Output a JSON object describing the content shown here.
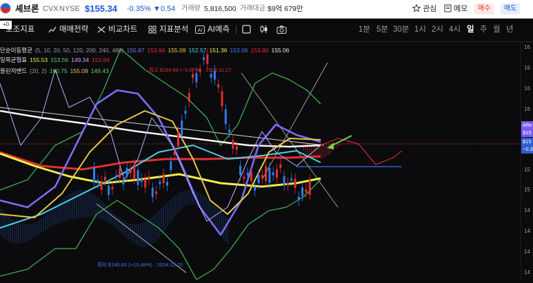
{
  "header": {
    "name": "셰브론",
    "ticker": "CVX",
    "exchange": "NYSE",
    "price": "$155.34",
    "change_pct": "-0.35%",
    "change_abs": "▼0.54",
    "volume_label": "거래량",
    "volume_value": "5,816,500",
    "amount_label": "거래대금",
    "amount_value": "$9억 679만",
    "watch_label": "관심",
    "memo_label": "메모",
    "buy_label": "매수",
    "sell_label": "매도"
  },
  "toolbar": {
    "tag": "+0",
    "aux_label": "보조지표",
    "strategy_label": "매매전략",
    "compare_label": "비교차트",
    "analysis_label": "지표분석",
    "ai_label": "AI예측",
    "periods": [
      "1분",
      "5분",
      "30분",
      "1시",
      "2시",
      "4시",
      "일",
      "주",
      "월",
      "년"
    ],
    "active_period": "일"
  },
  "legend": {
    "ma": {
      "label": "단순이동평균",
      "params": "(5, 10, 20, 50, 120, 200, 240, 480)",
      "values": [
        "155.87",
        "153.94",
        "155.09",
        "152.57",
        "151.36",
        "153.06",
        "153.80",
        "155.06"
      ]
    },
    "ichimoku": {
      "label": "일목균형표",
      "values": [
        "155.53",
        "153.56",
        "149.34",
        "152.64"
      ]
    },
    "bollinger": {
      "label": "볼린저밴드",
      "params": "(20, 2)",
      "values": [
        "160.75",
        "155.09",
        "149.43"
      ]
    }
  },
  "annotations": {
    "high": "최고 $164.68 (−5.67%) · 2024.11.27",
    "low": "최저 $140.60 (+10.48%) · 2024.12.20"
  },
  "axis": {
    "ticks": [
      "16",
      "16",
      "16",
      "16",
      "15",
      "15",
      "15",
      "14",
      "14",
      "14",
      "14"
    ],
    "after_hours_label": "Afte",
    "tag_price": "$15",
    "tag_change": "−0.3",
    "tag_price2": "$15"
  },
  "colors": {
    "up": "#e2312f",
    "down": "#2f7bf5",
    "accent": "#2b62c9"
  },
  "icons": {
    "aux": "indicator-icon",
    "strategy": "chart-icon",
    "compare": "compare-icon",
    "analysis": "grid-icon",
    "ai": "ai-icon",
    "square": "square-icon",
    "candle": "candle-icon",
    "camera": "camera-icon",
    "watch": "star-icon",
    "memo": "memo-icon",
    "arrow": "arrow-icon"
  }
}
